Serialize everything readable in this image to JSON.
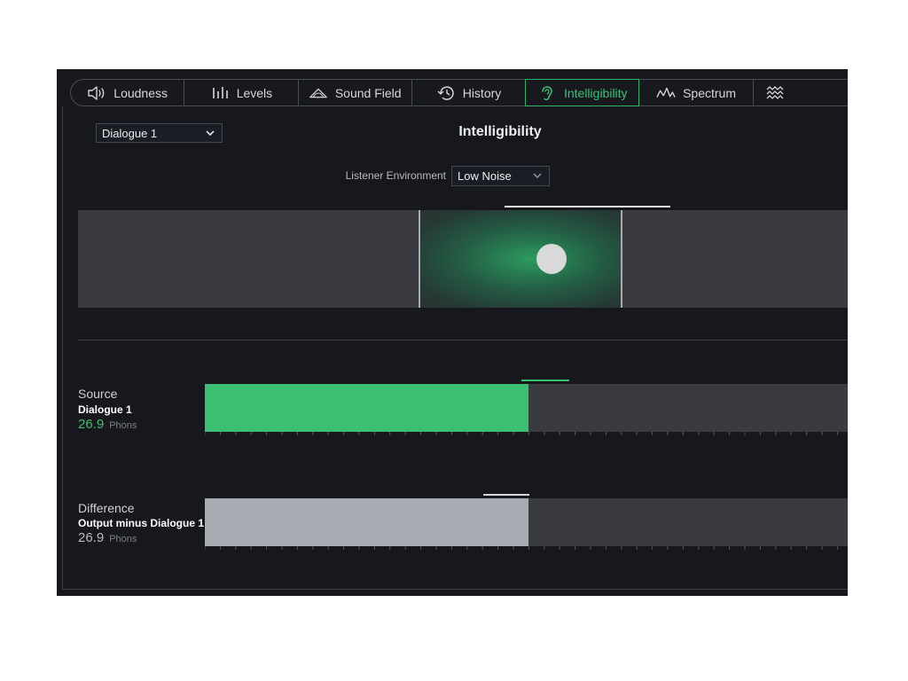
{
  "tabs": [
    {
      "label": "Loudness",
      "icon": "speaker-icon"
    },
    {
      "label": "Levels",
      "icon": "levels-icon"
    },
    {
      "label": "Sound Field",
      "icon": "sound-field-icon"
    },
    {
      "label": "History",
      "icon": "history-icon"
    },
    {
      "label": "Intelligibility",
      "icon": "ear-icon",
      "active": true
    },
    {
      "label": "Spectrum",
      "icon": "spectrum-icon"
    },
    {
      "label": "",
      "icon": "spectrogram-icon"
    }
  ],
  "source_select": {
    "value": "Dialogue 1"
  },
  "page_title": "Intelligibility",
  "environment": {
    "label": "Listener Environment",
    "value": "Low Noise"
  },
  "meters": [
    {
      "label": "Source",
      "sublabel": "Dialogue 1",
      "value": "26.9",
      "unit": "Phons",
      "fill_fraction": 0.5,
      "color": "#3dbf72",
      "value_color": "#3dbf72"
    },
    {
      "label": "Difference",
      "sublabel": "Output minus Dialogue 1",
      "value": "26.9",
      "unit": "Phons",
      "fill_fraction": 0.5,
      "color": "#a9abb2",
      "value_color": "#b9bbc1"
    }
  ],
  "colors": {
    "accent": "#35c474",
    "background": "#16181e"
  }
}
